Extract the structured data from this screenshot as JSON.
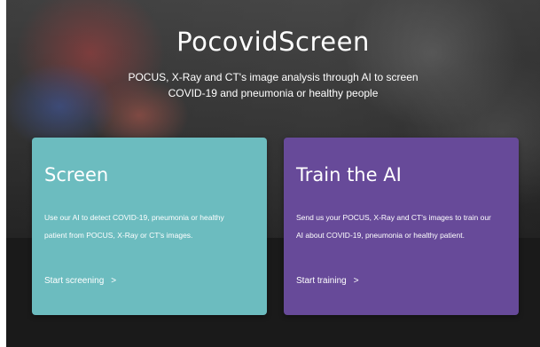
{
  "hero": {
    "title": "PocovidScreen",
    "subtitle_line1": "POCUS, X-Ray and CT's image analysis through AI to screen",
    "subtitle_line2": "COVID-19 and pneumonia or healthy people"
  },
  "cards": [
    {
      "title": "Screen",
      "description_line1": "Use our AI to detect COVID-19, pneumonia or healthy",
      "description_line2": "patient from POCUS, X-Ray or CT's images.",
      "link_label": "Start screening",
      "arrow": ">",
      "color": "#6cbcbf"
    },
    {
      "title": "Train the AI",
      "description_line1": "Send us your POCUS, X-Ray and CT's images to train our",
      "description_line2": "AI about COVID-19, pneumonia or healthy patient.",
      "link_label": "Start training",
      "arrow": ">",
      "color": "#674a99"
    }
  ]
}
